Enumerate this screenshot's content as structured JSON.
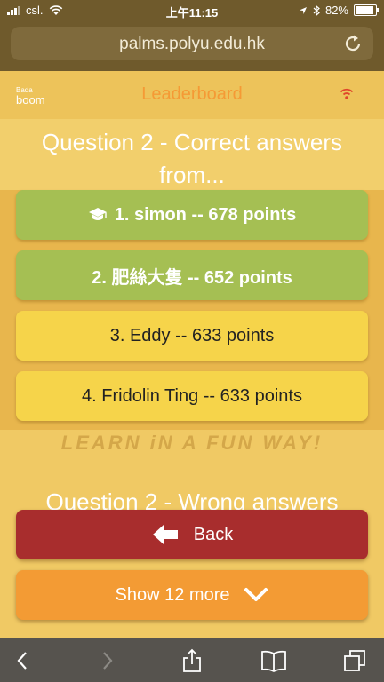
{
  "status_bar": {
    "carrier": "csl.",
    "time": "上午11:15",
    "battery": "82%",
    "icons": [
      "signal-icon",
      "wifi-icon",
      "location-icon",
      "bluetooth-icon",
      "battery-icon"
    ]
  },
  "browser": {
    "url": "palms.polyu.edu.hk",
    "icons": [
      "reload-icon",
      "back-icon",
      "forward-icon",
      "share-icon",
      "bookmarks-icon",
      "tabs-icon"
    ]
  },
  "app": {
    "logo_small": "Bada",
    "logo_big": "boom",
    "title": "Leaderboard",
    "accent": "#f59a35"
  },
  "correct_section": {
    "title": "Question 2 - Correct answers from...",
    "items": [
      {
        "label": "1. simon -- 678 points",
        "icon": "graduation-cap-icon"
      },
      {
        "label": "2. 肥絲大隻 -- 652 points"
      },
      {
        "label": "3. Eddy -- 633 points"
      },
      {
        "label": "4. Fridolin Ting -- 633 points"
      }
    ]
  },
  "watermark": "LEARN iN A FUN WAY!",
  "wrong_section": {
    "title": "Question 2 - Wrong answers"
  },
  "buttons": {
    "back": "Back",
    "more": "Show 12 more"
  },
  "colors": {
    "green": "#a5bf53",
    "yellow": "#f6d44a",
    "red": "#a82d2d",
    "orange": "#f39b34"
  }
}
